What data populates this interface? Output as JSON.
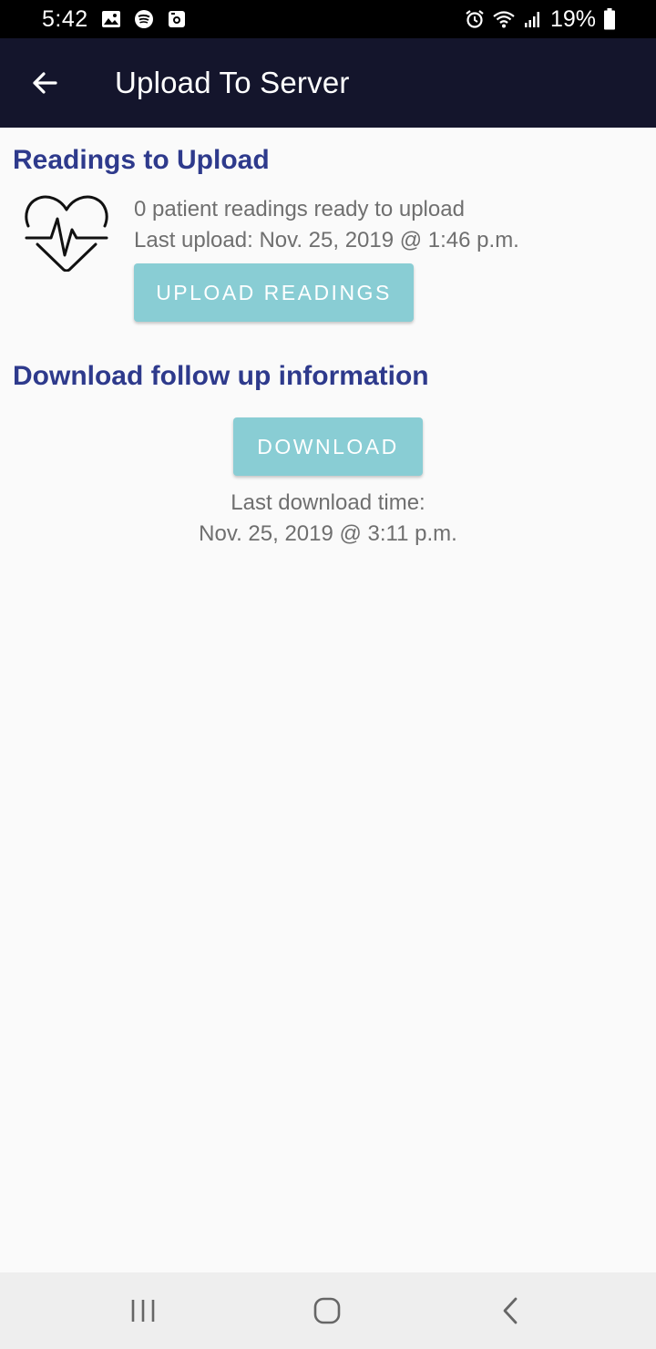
{
  "status_bar": {
    "time": "5:42",
    "battery_percent": "19%",
    "left_icons": [
      "gallery-icon",
      "spotify-icon",
      "camera-app-icon"
    ],
    "right_icons": [
      "alarm-icon",
      "wifi-icon",
      "signal-icon",
      "battery-icon"
    ]
  },
  "app_bar": {
    "title": "Upload To Server",
    "back_icon": "arrow-left-icon"
  },
  "readings": {
    "heading": "Readings to Upload",
    "icon": "heart-pulse-icon",
    "ready_text": "0 patient readings ready to upload",
    "last_upload_text": "Last upload: Nov. 25, 2019 @ 1:46 p.m.",
    "button_label": "UPLOAD READINGS"
  },
  "download": {
    "heading": "Download follow up information",
    "button_label": "DOWNLOAD",
    "last_download_label": "Last download time:",
    "last_download_time": "Nov. 25, 2019 @ 3:11 p.m."
  },
  "nav_bar": {
    "icons": [
      "recent-apps-icon",
      "home-icon",
      "back-icon"
    ]
  },
  "colors": {
    "app_bar_bg": "#14152c",
    "heading": "#2e3a8c",
    "button_bg": "#89cdd4",
    "body_text": "#6f6f6f",
    "background": "#fafafa"
  }
}
